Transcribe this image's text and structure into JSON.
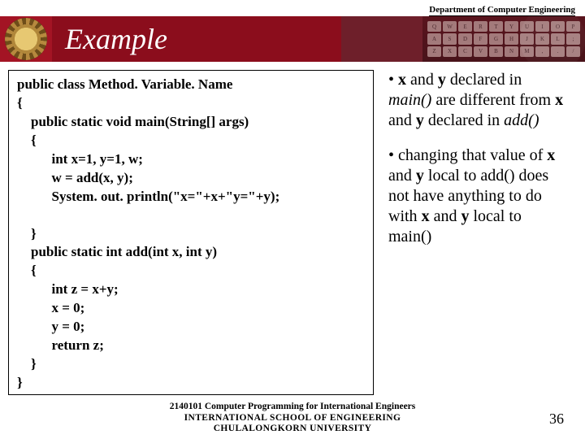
{
  "header": {
    "department": "Department of Computer Engineering",
    "title": "Example"
  },
  "code": "public class Method. Variable. Name\n{\n    public static void main(String[] args)\n    {\n          int x=1, y=1, w;\n          w = add(x, y);\n          System. out. println(\"x=\"+x+\"y=\"+y);\n\n    }\n    public static int add(int x, int y)\n    {\n          int z = x+y;\n          x = 0;\n          y = 0;\n          return z;\n    }\n}",
  "notes": {
    "p1_pre": "• ",
    "p1_x": "x",
    "p1_mid1": " and ",
    "p1_y": "y",
    "p1_mid2": " declared in ",
    "p1_main": "main()",
    "p1_mid3": " are different from ",
    "p1_x2": "x",
    "p1_mid4": " and ",
    "p1_y2": "y",
    "p1_mid5": " declared in ",
    "p1_add": "add()",
    "p2_pre": "• changing that value of ",
    "p2_x": "x",
    "p2_mid1": " and ",
    "p2_y": "y",
    "p2_mid2": " local to add() does not have anything to do with ",
    "p2_x2": "x",
    "p2_mid3": " and ",
    "p2_y2": "y",
    "p2_mid4": " local to main()"
  },
  "footer": {
    "line1": "2140101 Computer Programming for International Engineers",
    "line2": "INTERNATIONAL SCHOOL OF ENGINEERING",
    "line3": "CHULALONGKORN UNIVERSITY",
    "page": "36"
  }
}
